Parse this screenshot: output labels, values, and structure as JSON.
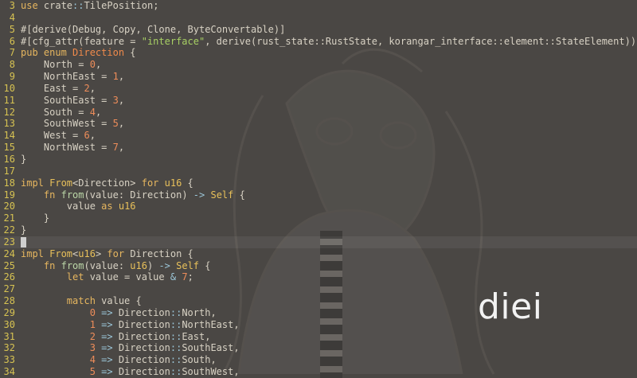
{
  "editor": {
    "lines": [
      {
        "n": "3",
        "tokens": [
          [
            "k",
            "use"
          ],
          [
            "t",
            " crate"
          ],
          [
            "op",
            "::"
          ],
          [
            "t",
            "TilePosition;"
          ]
        ]
      },
      {
        "n": "4",
        "tokens": []
      },
      {
        "n": "5",
        "tokens": [
          [
            "t",
            "#[derive(Debug, Copy, Clone, ByteConvertable)]"
          ]
        ]
      },
      {
        "n": "6",
        "tokens": [
          [
            "t",
            "#[cfg_attr(feature = "
          ],
          [
            "s",
            "\"interface\""
          ],
          [
            "t",
            ", derive(rust_state::RustState, korangar_interface::element::StateElement))]"
          ]
        ]
      },
      {
        "n": "7",
        "tokens": [
          [
            "k",
            "pub enum "
          ],
          [
            "en",
            "Direction"
          ],
          [
            "t",
            " {"
          ]
        ]
      },
      {
        "n": "8",
        "tokens": [
          [
            "t",
            "    North = "
          ],
          [
            "n",
            "0"
          ],
          [
            "t",
            ","
          ]
        ]
      },
      {
        "n": "9",
        "tokens": [
          [
            "t",
            "    NorthEast = "
          ],
          [
            "n",
            "1"
          ],
          [
            "t",
            ","
          ]
        ]
      },
      {
        "n": "10",
        "tokens": [
          [
            "t",
            "    East = "
          ],
          [
            "n",
            "2"
          ],
          [
            "t",
            ","
          ]
        ]
      },
      {
        "n": "11",
        "tokens": [
          [
            "t",
            "    SouthEast = "
          ],
          [
            "n",
            "3"
          ],
          [
            "t",
            ","
          ]
        ]
      },
      {
        "n": "12",
        "tokens": [
          [
            "t",
            "    South = "
          ],
          [
            "n",
            "4"
          ],
          [
            "t",
            ","
          ]
        ]
      },
      {
        "n": "13",
        "tokens": [
          [
            "t",
            "    SouthWest = "
          ],
          [
            "n",
            "5"
          ],
          [
            "t",
            ","
          ]
        ]
      },
      {
        "n": "14",
        "tokens": [
          [
            "t",
            "    West = "
          ],
          [
            "n",
            "6"
          ],
          [
            "t",
            ","
          ]
        ]
      },
      {
        "n": "15",
        "tokens": [
          [
            "t",
            "    NorthWest = "
          ],
          [
            "n",
            "7"
          ],
          [
            "t",
            ","
          ]
        ]
      },
      {
        "n": "16",
        "tokens": [
          [
            "t",
            "}"
          ]
        ]
      },
      {
        "n": "17",
        "tokens": []
      },
      {
        "n": "18",
        "tokens": [
          [
            "k",
            "impl "
          ],
          [
            "ty",
            "From"
          ],
          [
            "t",
            "<Direction> "
          ],
          [
            "k",
            "for "
          ],
          [
            "ty",
            "u16"
          ],
          [
            "t",
            " {"
          ]
        ]
      },
      {
        "n": "19",
        "tokens": [
          [
            "t",
            "    "
          ],
          [
            "k",
            "fn "
          ],
          [
            "f",
            "from"
          ],
          [
            "t",
            "(value: Direction) "
          ],
          [
            "op",
            "->"
          ],
          [
            "t",
            " "
          ],
          [
            "ty",
            "Self"
          ],
          [
            "t",
            " {"
          ]
        ]
      },
      {
        "n": "20",
        "tokens": [
          [
            "t",
            "        value "
          ],
          [
            "k",
            "as "
          ],
          [
            "ty",
            "u16"
          ]
        ]
      },
      {
        "n": "21",
        "tokens": [
          [
            "t",
            "    }"
          ]
        ]
      },
      {
        "n": "22",
        "tokens": [
          [
            "t",
            "}"
          ]
        ]
      },
      {
        "n": "23",
        "current": true,
        "tokens": []
      },
      {
        "n": "24",
        "tokens": [
          [
            "k",
            "impl "
          ],
          [
            "ty",
            "From"
          ],
          [
            "t",
            "<"
          ],
          [
            "ty",
            "u16"
          ],
          [
            "t",
            "> "
          ],
          [
            "k",
            "for "
          ],
          [
            "t",
            "Direction {"
          ]
        ]
      },
      {
        "n": "25",
        "tokens": [
          [
            "t",
            "    "
          ],
          [
            "k",
            "fn "
          ],
          [
            "f",
            "from"
          ],
          [
            "t",
            "(value: "
          ],
          [
            "ty",
            "u16"
          ],
          [
            "t",
            ") "
          ],
          [
            "op",
            "->"
          ],
          [
            "t",
            " "
          ],
          [
            "ty",
            "Self"
          ],
          [
            "t",
            " {"
          ]
        ]
      },
      {
        "n": "26",
        "tokens": [
          [
            "t",
            "        "
          ],
          [
            "k",
            "let "
          ],
          [
            "t",
            "value = value "
          ],
          [
            "op",
            "&"
          ],
          [
            "t",
            " "
          ],
          [
            "n",
            "7"
          ],
          [
            "t",
            ";"
          ]
        ]
      },
      {
        "n": "27",
        "tokens": []
      },
      {
        "n": "28",
        "tokens": [
          [
            "t",
            "        "
          ],
          [
            "k",
            "match "
          ],
          [
            "t",
            "value {"
          ]
        ]
      },
      {
        "n": "29",
        "tokens": [
          [
            "t",
            "            "
          ],
          [
            "n",
            "0"
          ],
          [
            "t",
            " "
          ],
          [
            "op",
            "=>"
          ],
          [
            "t",
            " Direction"
          ],
          [
            "op",
            "::"
          ],
          [
            "t",
            "North,"
          ]
        ]
      },
      {
        "n": "30",
        "tokens": [
          [
            "t",
            "            "
          ],
          [
            "n",
            "1"
          ],
          [
            "t",
            " "
          ],
          [
            "op",
            "=>"
          ],
          [
            "t",
            " Direction"
          ],
          [
            "op",
            "::"
          ],
          [
            "t",
            "NorthEast,"
          ]
        ]
      },
      {
        "n": "31",
        "tokens": [
          [
            "t",
            "            "
          ],
          [
            "n",
            "2"
          ],
          [
            "t",
            " "
          ],
          [
            "op",
            "=>"
          ],
          [
            "t",
            " Direction"
          ],
          [
            "op",
            "::"
          ],
          [
            "t",
            "East,"
          ]
        ]
      },
      {
        "n": "32",
        "tokens": [
          [
            "t",
            "            "
          ],
          [
            "n",
            "3"
          ],
          [
            "t",
            " "
          ],
          [
            "op",
            "=>"
          ],
          [
            "t",
            " Direction"
          ],
          [
            "op",
            "::"
          ],
          [
            "t",
            "SouthEast,"
          ]
        ]
      },
      {
        "n": "33",
        "tokens": [
          [
            "t",
            "            "
          ],
          [
            "n",
            "4"
          ],
          [
            "t",
            " "
          ],
          [
            "op",
            "=>"
          ],
          [
            "t",
            " Direction"
          ],
          [
            "op",
            "::"
          ],
          [
            "t",
            "South,"
          ]
        ]
      },
      {
        "n": "34",
        "tokens": [
          [
            "t",
            "            "
          ],
          [
            "n",
            "5"
          ],
          [
            "t",
            " "
          ],
          [
            "op",
            "=>"
          ],
          [
            "t",
            " Direction"
          ],
          [
            "op",
            "::"
          ],
          [
            "t",
            "SouthWest,"
          ]
        ]
      }
    ]
  },
  "overlay": {
    "text": "diei"
  }
}
